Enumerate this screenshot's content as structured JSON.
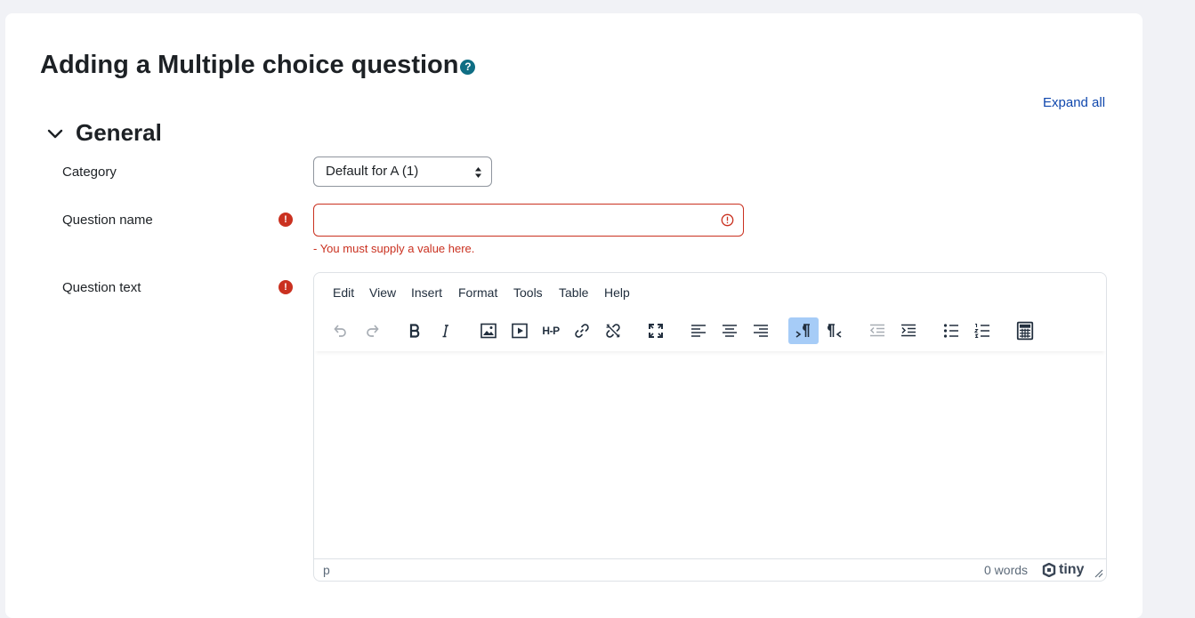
{
  "page": {
    "title": "Adding a Multiple choice question",
    "help_icon": "?",
    "expand_all": "Expand all"
  },
  "section": {
    "title": "General"
  },
  "fields": {
    "category": {
      "label": "Category",
      "value": "Default for A (1)"
    },
    "question_name": {
      "label": "Question name",
      "value": "",
      "error": "- You must supply a value here."
    },
    "question_text": {
      "label": "Question text"
    }
  },
  "required_icon": "!",
  "editor": {
    "menu": [
      "Edit",
      "View",
      "Insert",
      "Format",
      "Tools",
      "Table",
      "Help"
    ],
    "toolbar_icons": [
      "undo-icon",
      "redo-icon",
      "bold-icon",
      "italic-icon",
      "image-icon",
      "media-icon",
      "h5p-icon",
      "link-icon",
      "unlink-icon",
      "fullscreen-icon",
      "align-left-icon",
      "align-center-icon",
      "align-right-icon",
      "ltr-icon",
      "rtl-icon",
      "outdent-icon",
      "indent-icon",
      "bullet-list-icon",
      "numbered-list-icon",
      "calculator-icon"
    ],
    "h5p_label": "H-P",
    "status_path": "p",
    "word_count": "0 words",
    "brand": "tiny"
  },
  "colors": {
    "accent": "#0f47ad",
    "error": "#ca3120",
    "help": "#0f6e84",
    "active_tool": "#a6ccf7"
  }
}
